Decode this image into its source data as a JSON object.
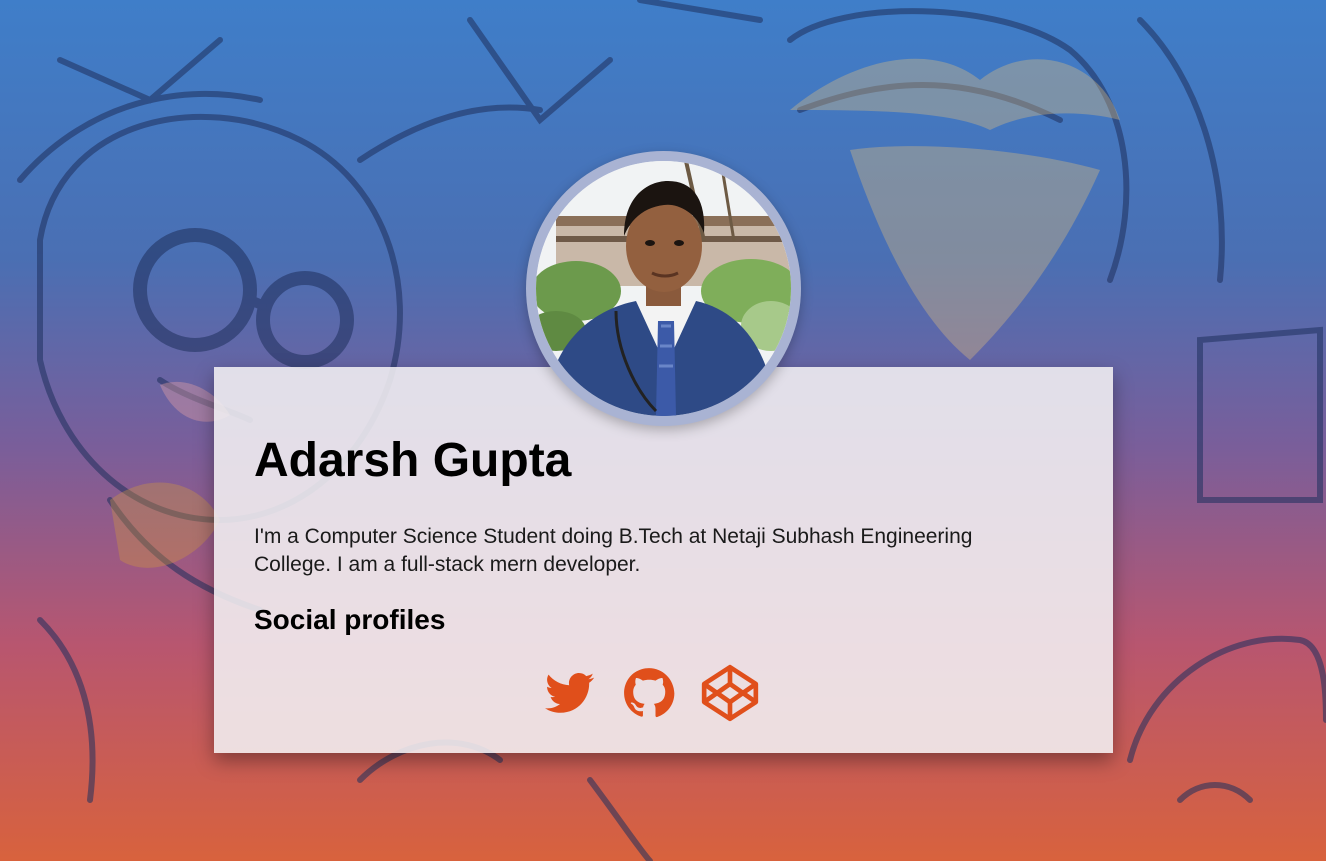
{
  "profile": {
    "name": "Adarsh Gupta",
    "bio": "I'm a Computer Science Student doing B.Tech at Netaji Subhash Engineering College. I am a full-stack mern developer.",
    "social_heading": "Social profiles"
  },
  "social_links": [
    {
      "icon": "twitter-icon"
    },
    {
      "icon": "github-icon"
    },
    {
      "icon": "codepen-icon"
    }
  ],
  "colors": {
    "accent": "#e04f1b",
    "card_bg": "#f3f0f2",
    "bg_top": "#3f7ec9",
    "bg_bottom": "#d8623d"
  }
}
